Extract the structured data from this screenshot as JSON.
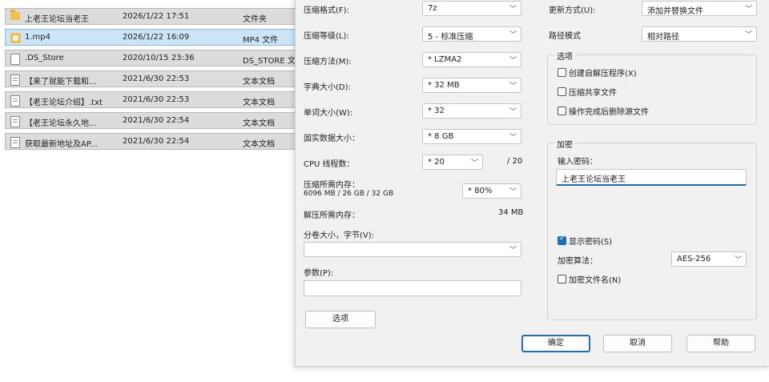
{
  "files": [
    {
      "icon": "folder",
      "name": "上老王论坛当老王",
      "date": "2026/1/22 17:51",
      "type": "文件夹",
      "selected": false
    },
    {
      "icon": "mp4",
      "name": "1.mp4",
      "date": "2026/1/22 16:09",
      "type": "MP4 文件",
      "selected": true
    },
    {
      "icon": "blank",
      "name": ".DS_Store",
      "date": "2020/10/15 23:36",
      "type": "DS_STORE 文件",
      "selected": false
    },
    {
      "icon": "doc",
      "name": "【来了就能下载和...",
      "date": "2021/6/30 22:53",
      "type": "文本文档",
      "selected": false
    },
    {
      "icon": "doc",
      "name": "【老王论坛介绍】.txt",
      "date": "2021/6/30 22:53",
      "type": "文本文档",
      "selected": false
    },
    {
      "icon": "doc",
      "name": "【老王论坛永久地...",
      "date": "2021/6/30 22:54",
      "type": "文本文档",
      "selected": false
    },
    {
      "icon": "doc",
      "name": "获取最新地址及AP...",
      "date": "2021/6/30 22:54",
      "type": "文本文档",
      "selected": false
    }
  ],
  "left": {
    "format": {
      "label": "压缩格式(F):",
      "value": "7z"
    },
    "level": {
      "label": "压缩等级(L):",
      "value": "5 - 标准压缩"
    },
    "method": {
      "label": "压缩方法(M):",
      "value": "* LZMA2"
    },
    "dict": {
      "label": "字典大小(D):",
      "value": "* 32 MB"
    },
    "word": {
      "label": "单词大小(W):",
      "value": "* 32"
    },
    "solid": {
      "label": "固实数据大小：",
      "value": "* 8 GB"
    },
    "threads": {
      "label": "CPU 线程数：",
      "value": "* 20",
      "max": "/ 20"
    },
    "mem_compress": {
      "label": "压缩所需内存：",
      "detail": "6096 MB / 26 GB / 32 GB",
      "value": "* 80%"
    },
    "mem_decompress": {
      "label": "解压所需内存：",
      "value": "34 MB"
    },
    "split": {
      "label": "分卷大小，字节(V):",
      "value": ""
    },
    "params": {
      "label": "参数(P):",
      "value": ""
    },
    "options_btn": "选项"
  },
  "right": {
    "update": {
      "label": "更新方式(U):",
      "value": "添加并替换文件"
    },
    "pathmode": {
      "label": "路径模式",
      "value": "相对路径"
    },
    "options_group": {
      "title": "选项",
      "sfx": {
        "label": "创建自解压程序(X)",
        "checked": false
      },
      "shared": {
        "label": "压缩共享文件",
        "checked": false
      },
      "delete": {
        "label": "操作完成后删除源文件",
        "checked": false
      }
    },
    "encrypt_group": {
      "title": "加密",
      "pwd_label": "输入密码：",
      "pwd_value": "上老王论坛当老王",
      "show_pwd": {
        "label": "显示密码(S)",
        "checked": true
      },
      "algo_label": "加密算法：",
      "algo_value": "AES-256",
      "enc_names": {
        "label": "加密文件名(N)",
        "checked": false
      }
    }
  },
  "buttons": {
    "ok": "确定",
    "cancel": "取消",
    "help": "帮助"
  },
  "icons": {
    "chevron": "chevron-down-icon"
  }
}
